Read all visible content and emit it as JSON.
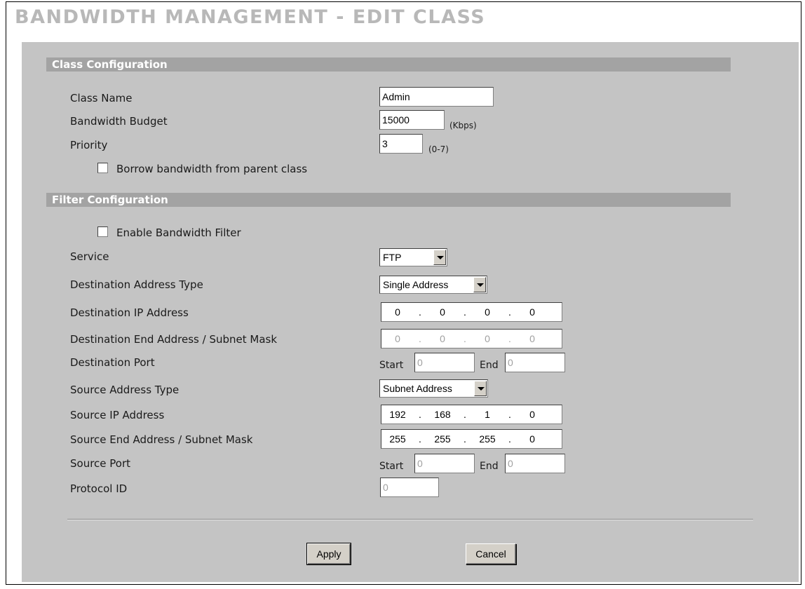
{
  "title": "BANDWIDTH MANAGEMENT - EDIT CLASS",
  "class_config": {
    "header": "Class Configuration",
    "class_name_label": "Class Name",
    "class_name_value": "Admin",
    "budget_label": "Bandwidth Budget",
    "budget_value": "15000",
    "budget_unit": "(Kbps)",
    "priority_label": "Priority",
    "priority_value": "3",
    "priority_range": "(0-7)",
    "borrow_label": "Borrow bandwidth from parent class",
    "borrow_checked": false
  },
  "filter_config": {
    "header": "Filter Configuration",
    "enable_label": "Enable Bandwidth Filter",
    "enable_checked": false,
    "service_label": "Service",
    "service_value": "FTP",
    "dest_type_label": "Destination Address Type",
    "dest_type_value": "Single Address",
    "dest_ip_label": "Destination IP Address",
    "dest_ip": [
      "0",
      "0",
      "0",
      "0"
    ],
    "dest_end_label": "Destination End Address / Subnet Mask",
    "dest_end": [
      "0",
      "0",
      "0",
      "0"
    ],
    "dest_port_label": "Destination Port",
    "dest_port_start_label": "Start",
    "dest_port_start": "0",
    "dest_port_end_label": "End",
    "dest_port_end": "0",
    "src_type_label": "Source Address Type",
    "src_type_value": "Subnet Address",
    "src_ip_label": "Source IP Address",
    "src_ip": [
      "192",
      "168",
      "1",
      "0"
    ],
    "src_end_label": "Source End Address / Subnet Mask",
    "src_end": [
      "255",
      "255",
      "255",
      "0"
    ],
    "src_port_label": "Source Port",
    "src_port_start_label": "Start",
    "src_port_start": "0",
    "src_port_end_label": "End",
    "src_port_end": "0",
    "protocol_label": "Protocol ID",
    "protocol_value": "0"
  },
  "buttons": {
    "apply": "Apply",
    "cancel": "Cancel"
  }
}
